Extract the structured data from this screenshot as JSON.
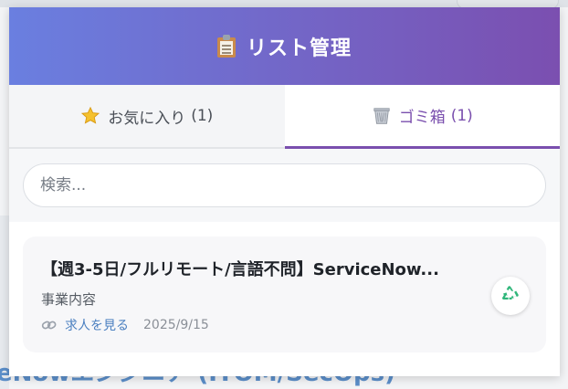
{
  "background": {
    "partial_heading": "eNowエンジニア (ITOM/SecOps)"
  },
  "header": {
    "icon": "clipboard-icon",
    "title": "リスト管理"
  },
  "tabs": [
    {
      "icon": "star-icon",
      "label": "お気に入り",
      "count": "(1)",
      "active": false
    },
    {
      "icon": "trash-icon",
      "label": "ゴミ箱",
      "count": "(1)",
      "active": true
    }
  ],
  "search": {
    "placeholder": "検索..."
  },
  "items": [
    {
      "title": "【週3-5日/フルリモート/言語不問】ServiceNow...",
      "description": "事業内容",
      "link_icon": "link-icon",
      "link_label": "求人を見る",
      "date": "2025/9/15",
      "action_icon": "recycle-icon"
    }
  ],
  "colors": {
    "header_gradient_start": "#6a7fe0",
    "header_gradient_end": "#7b4fb0",
    "accent": "#7a4fae",
    "link": "#4a7fc0",
    "recycle": "#2fb67a"
  }
}
